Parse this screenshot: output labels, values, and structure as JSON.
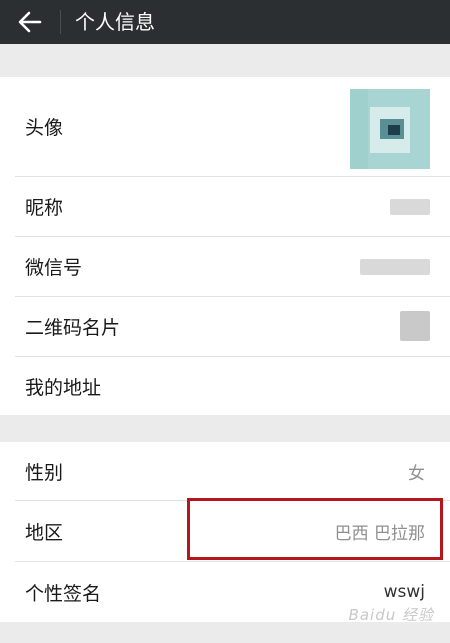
{
  "header": {
    "title": "个人信息",
    "back_icon": "back-arrow-icon"
  },
  "rows_section1": [
    {
      "label": "头像",
      "value": ""
    },
    {
      "label": "昵称",
      "value": ""
    },
    {
      "label": "微信号",
      "value": ""
    },
    {
      "label": "二维码名片",
      "value": ""
    },
    {
      "label": "我的地址",
      "value": ""
    }
  ],
  "rows_section2": [
    {
      "label": "性别",
      "value": "女"
    },
    {
      "label": "地区",
      "value": "巴西 巴拉那"
    },
    {
      "label": "个性签名",
      "value": "wswj"
    }
  ],
  "watermark": "Baidu 经验",
  "colors": {
    "topbar": "#2c2f31",
    "highlight": "#b5161c",
    "background": "#ebebeb"
  }
}
